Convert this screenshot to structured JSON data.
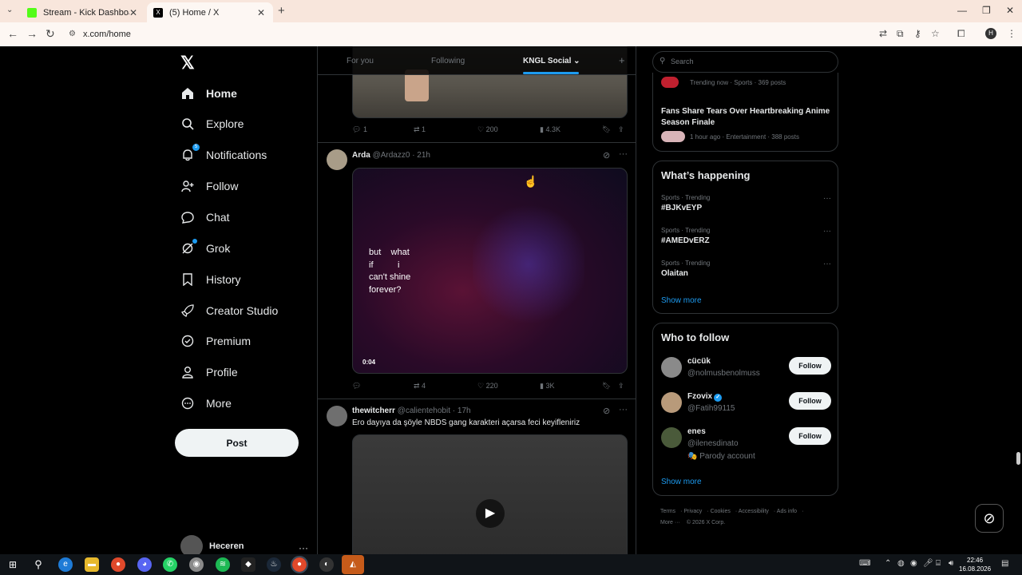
{
  "browser": {
    "tabs": [
      {
        "title": "Stream - Kick Dashboard",
        "favicon_color": "#53fc18"
      },
      {
        "title": "(5) Home / X",
        "favicon_color": "#000000"
      }
    ],
    "url": "x.com/home"
  },
  "nav": {
    "logo": "𝕏",
    "items": [
      {
        "label": "Home",
        "icon": "home-icon",
        "glyph": "⌂"
      },
      {
        "label": "Explore",
        "icon": "search-icon",
        "glyph": "⚲"
      },
      {
        "label": "Notifications",
        "icon": "bell-icon",
        "glyph": "🔔︎",
        "badge": "5"
      },
      {
        "label": "Follow",
        "icon": "person-add-icon",
        "glyph": "👤︎"
      },
      {
        "label": "Chat",
        "icon": "chat-icon",
        "glyph": "💬︎"
      },
      {
        "label": "Grok",
        "icon": "grok-icon",
        "glyph": "⊘"
      },
      {
        "label": "History",
        "icon": "bookmark-icon",
        "glyph": "🔖︎"
      },
      {
        "label": "Creator Studio",
        "icon": "rocket-icon",
        "glyph": "➚"
      },
      {
        "label": "Premium",
        "icon": "verified-icon",
        "glyph": "✓"
      },
      {
        "label": "Profile",
        "icon": "profile-icon",
        "glyph": "👤︎"
      },
      {
        "label": "More",
        "icon": "more-icon",
        "glyph": "⋯"
      }
    ],
    "post_label": "Post",
    "account_name": "Heceren"
  },
  "feed": {
    "tabs": {
      "for_you": "For you",
      "following": "Following",
      "active": "KNGL Social",
      "chevron": "⌄",
      "add": "+"
    },
    "post0": {
      "replies": "1",
      "reposts": "1",
      "likes": "200",
      "views": "4.3K"
    },
    "post1": {
      "name": "Arda",
      "handle": "@Ardazz0",
      "time": "· 21h",
      "overlay_lines": [
        "but    what",
        "if          i",
        "can't shine",
        "forever?"
      ],
      "duration": "0:04",
      "replies": "",
      "reposts": "4",
      "likes": "220",
      "views": "3K"
    },
    "post2": {
      "name": "thewitcherr",
      "handle": "@calientehobit",
      "time": "· 17h",
      "text": "Ero dayıya da şöyle NBDS gang karakteri açarsa feci keyifleniriz"
    }
  },
  "sidebar": {
    "search_placeholder": "Search",
    "trend_top": {
      "meta": "Trending now · Sports · 369 posts"
    },
    "trend_top2": {
      "title": "Fans Share Tears Over Heartbreaking Anime Season Finale",
      "meta": "1 hour ago · Entertainment · 388 posts"
    },
    "whats_happening": {
      "title": "What’s happening",
      "items": [
        {
          "meta": "Sports · Trending",
          "tag": "#BJKvEYP"
        },
        {
          "meta": "Sports · Trending",
          "tag": "#AMEDvERZ"
        },
        {
          "meta": "Sports · Trending",
          "tag": "Olaitan"
        }
      ],
      "show_more": "Show more"
    },
    "who_to_follow": {
      "title": "Who to follow",
      "users": [
        {
          "name": "cücük",
          "handle": "@nolmusbenolmuss",
          "color": "#8a8a8a"
        },
        {
          "name": "Fzovix",
          "handle": "@Fatih99115",
          "verified": true,
          "color": "#b89a7a"
        },
        {
          "name": "enes",
          "handle": "@ilenesdinato",
          "extra": "🎭 Parody account",
          "color": "#4a5a3a"
        }
      ],
      "follow_label": "Follow",
      "show_more": "Show more"
    },
    "footer": [
      "Terms",
      "Privacy",
      "Cookies",
      "Accessibility",
      "Ads info",
      "More ···",
      "© 2026 X Corp."
    ]
  },
  "taskbar": {
    "time": "22:46",
    "date": "16.08.2026"
  }
}
